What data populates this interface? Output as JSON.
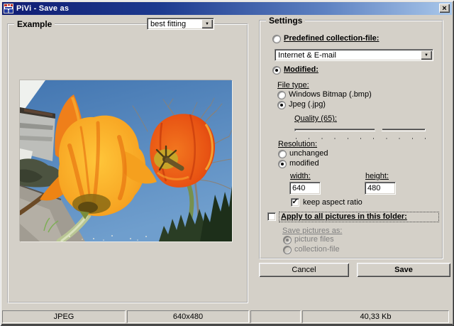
{
  "window": {
    "title": "PiVi - Save as"
  },
  "icons": {
    "close": "×",
    "dropdown_arrow": "▼",
    "check": "✓"
  },
  "example": {
    "group_label": "Example",
    "filter_dropdown": {
      "value": "best fitting"
    }
  },
  "settings": {
    "group_label": "Settings",
    "predefined": {
      "label": "Predefined collection-file:",
      "selected": false
    },
    "collection_dropdown": {
      "value": "Internet & E-mail"
    },
    "modified": {
      "label": "Modified:",
      "selected": true
    },
    "file_type": {
      "label": "File type:",
      "options": [
        {
          "label": "Windows Bitmap (.bmp)",
          "selected": false
        },
        {
          "label": "Jpeg (.jpg)",
          "selected": true
        }
      ]
    },
    "quality": {
      "label": "Quality (65):",
      "value": 65
    },
    "resolution": {
      "label": "Resolution:",
      "options": [
        {
          "label": "unchanged",
          "selected": false
        },
        {
          "label": "modified",
          "selected": true
        }
      ],
      "width_label": "width:",
      "width_value": "640",
      "height_label": "height:",
      "height_value": "480",
      "keep_aspect_label": "keep aspect ratio",
      "keep_aspect_checked": true
    },
    "apply_all": {
      "label": "Apply to all pictures in this folder:",
      "checked": false
    },
    "save_pictures_as": {
      "label": "Save pictures as:",
      "options": [
        {
          "label": "picture files",
          "selected": true,
          "disabled": true
        },
        {
          "label": "collection-file",
          "selected": false,
          "disabled": true
        }
      ]
    }
  },
  "buttons": {
    "cancel": "Cancel",
    "save": "Save"
  },
  "status_bar": {
    "format": "JPEG",
    "dimensions": "640x480",
    "file_size": "40,33 Kb"
  }
}
